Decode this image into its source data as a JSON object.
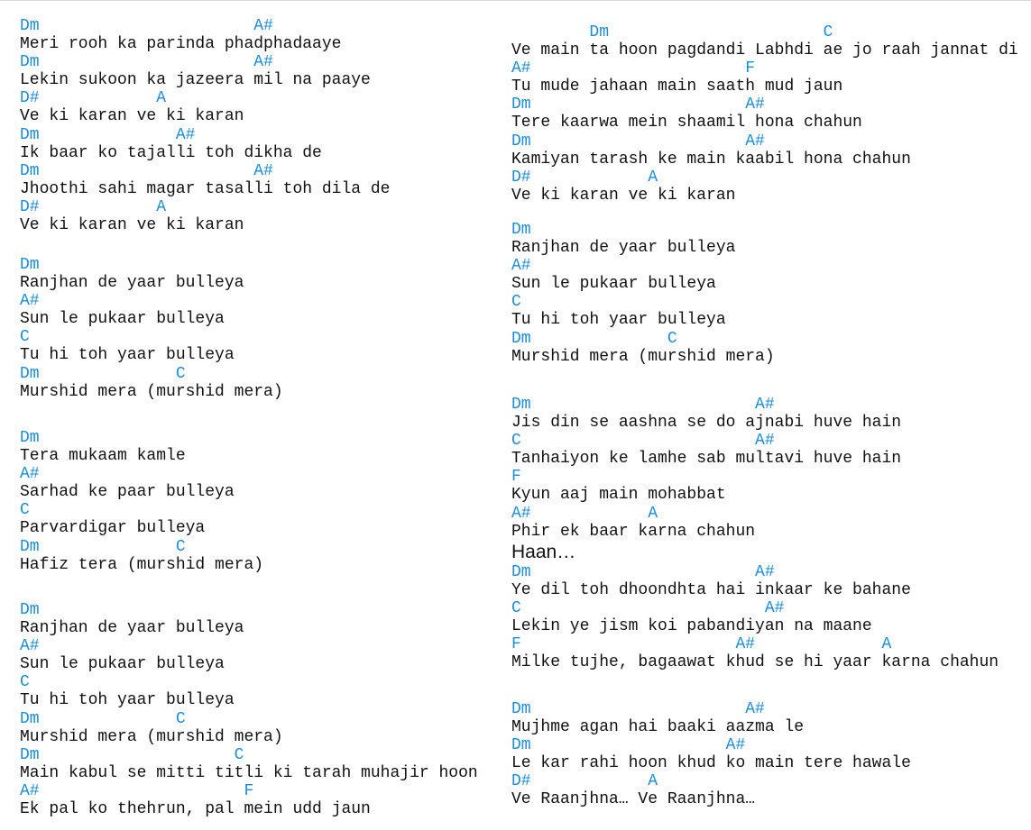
{
  "colors": {
    "chord": "#1f8cd3",
    "lyric": "#111111"
  },
  "columns": [
    {
      "stanzas": [
        [
          {
            "type": "chord",
            "text": "Dm                      A#"
          },
          {
            "type": "lyric",
            "text": "Meri rooh ka parinda phadphadaaye"
          },
          {
            "type": "chord",
            "text": "Dm                      A#"
          },
          {
            "type": "lyric",
            "text": "Lekin sukoon ka jazeera mil na paaye"
          },
          {
            "type": "chord",
            "text": "D#            A"
          },
          {
            "type": "lyric",
            "text": "Ve ki karan ve ki karan"
          },
          {
            "type": "chord",
            "text": "Dm              A#"
          },
          {
            "type": "lyric",
            "text": "Ik baar ko tajalli toh dikha de"
          },
          {
            "type": "chord",
            "text": "Dm                      A#"
          },
          {
            "type": "lyric",
            "text": "Jhoothi sahi magar tasalli toh dila de"
          },
          {
            "type": "chord",
            "text": "D#            A"
          },
          {
            "type": "lyric",
            "text": "Ve ki karan ve ki karan"
          }
        ],
        [
          {
            "type": "chord",
            "text": "Dm"
          },
          {
            "type": "lyric",
            "text": "Ranjhan de yaar bulleya"
          },
          {
            "type": "chord",
            "text": "A#"
          },
          {
            "type": "lyric",
            "text": "Sun le pukaar bulleya"
          },
          {
            "type": "chord",
            "text": "C"
          },
          {
            "type": "lyric",
            "text": "Tu hi toh yaar bulleya"
          },
          {
            "type": "chord",
            "text": "Dm              C"
          },
          {
            "type": "lyric",
            "text": "Murshid mera (murshid mera)"
          }
        ],
        [
          {
            "type": "chord",
            "text": "Dm"
          },
          {
            "type": "lyric",
            "text": "Tera mukaam kamle"
          },
          {
            "type": "chord",
            "text": "A#"
          },
          {
            "type": "lyric",
            "text": "Sarhad ke paar bulleya"
          },
          {
            "type": "chord",
            "text": "C"
          },
          {
            "type": "lyric",
            "text": "Parvardigar bulleya"
          },
          {
            "type": "chord",
            "text": "Dm              C"
          },
          {
            "type": "lyric",
            "text": "Hafiz tera (murshid mera)"
          }
        ],
        [
          {
            "type": "chord",
            "text": "Dm"
          },
          {
            "type": "lyric",
            "text": "Ranjhan de yaar bulleya"
          },
          {
            "type": "chord",
            "text": "A#"
          },
          {
            "type": "lyric",
            "text": "Sun le pukaar bulleya"
          },
          {
            "type": "chord",
            "text": "C"
          },
          {
            "type": "lyric",
            "text": "Tu hi toh yaar bulleya"
          },
          {
            "type": "chord",
            "text": "Dm              C"
          },
          {
            "type": "lyric",
            "text": "Murshid mera (murshid mera)"
          },
          {
            "type": "chord",
            "text": "Dm                    C"
          },
          {
            "type": "lyric",
            "text": "Main kabul se mitti titli ki tarah muhajir hoon"
          },
          {
            "type": "chord",
            "text": "A#                     F"
          },
          {
            "type": "lyric",
            "text": "Ek pal ko thehrun, pal mein udd jaun"
          }
        ]
      ]
    },
    {
      "stanzas": [
        [
          {
            "type": "chord",
            "text": "        Dm                      C"
          },
          {
            "type": "lyric",
            "text": "Ve main ta hoon pagdandi Labhdi ae jo raah jannat di"
          },
          {
            "type": "chord",
            "text": "A#                      F"
          },
          {
            "type": "lyric",
            "text": "Tu mude jahaan main saath mud jaun"
          },
          {
            "type": "chord",
            "text": "Dm                      A#"
          },
          {
            "type": "lyric",
            "text": "Tere kaarwa mein shaamil hona chahun"
          },
          {
            "type": "chord",
            "text": "Dm                      A#"
          },
          {
            "type": "lyric",
            "text": "Kamiyan tarash ke main kaabil hona chahun"
          },
          {
            "type": "chord",
            "text": "D#            A"
          },
          {
            "type": "lyric",
            "text": "Ve ki karan ve ki karan"
          }
        ],
        [
          {
            "type": "chord",
            "text": "Dm"
          },
          {
            "type": "lyric",
            "text": "Ranjhan de yaar bulleya"
          },
          {
            "type": "chord",
            "text": "A#"
          },
          {
            "type": "lyric",
            "text": "Sun le pukaar bulleya"
          },
          {
            "type": "chord",
            "text": "C"
          },
          {
            "type": "lyric",
            "text": "Tu hi toh yaar bulleya"
          },
          {
            "type": "chord",
            "text": "Dm              C"
          },
          {
            "type": "lyric",
            "text": "Murshid mera (murshid mera)"
          }
        ],
        [
          {
            "type": "chord",
            "text": "Dm                       A#"
          },
          {
            "type": "lyric",
            "text": "Jis din se aashna se do ajnabi huve hain"
          },
          {
            "type": "chord",
            "text": "C                        A#"
          },
          {
            "type": "lyric",
            "text": "Tanhaiyon ke lamhe sab multavi huve hain"
          },
          {
            "type": "chord",
            "text": "F"
          },
          {
            "type": "lyric",
            "text": "Kyun aaj main mohabbat"
          },
          {
            "type": "chord",
            "text": "A#            A"
          },
          {
            "type": "lyric",
            "text": "Phir ek baar karna chahun"
          },
          {
            "type": "text",
            "text": "Haan…"
          },
          {
            "type": "chord",
            "text": "Dm                       A#"
          },
          {
            "type": "lyric",
            "text": "Ye dil toh dhoondhta hai inkaar ke bahane"
          },
          {
            "type": "chord",
            "text": "C                         A#"
          },
          {
            "type": "lyric",
            "text": "Lekin ye jism koi pabandiyan na maane"
          },
          {
            "type": "chord",
            "text": "F                      A#             A"
          },
          {
            "type": "lyric",
            "text": "Milke tujhe, bagaawat khud se hi yaar karna chahun"
          }
        ],
        [
          {
            "type": "chord",
            "text": "Dm                      A#"
          },
          {
            "type": "lyric",
            "text": "Mujhme agan hai baaki aazma le"
          },
          {
            "type": "chord",
            "text": "Dm                    A#"
          },
          {
            "type": "lyric",
            "text": "Le kar rahi hoon khud ko main tere hawale"
          },
          {
            "type": "chord",
            "text": "D#            A"
          },
          {
            "type": "lyric",
            "text": "Ve Raanjhna… Ve Raanjhna…"
          }
        ]
      ]
    }
  ]
}
